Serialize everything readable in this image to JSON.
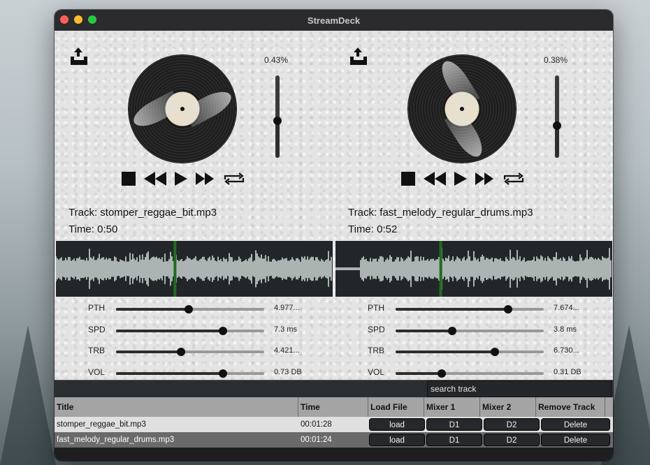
{
  "window": {
    "title": "StreamDeck"
  },
  "deck_left": {
    "volume_pct": "0.43%",
    "volume_level": 0.45,
    "track_label": "Track: stomper_reggae_bit.mp3",
    "time_label": "Time: 0:50",
    "playhead": 0.43,
    "params": [
      {
        "name": "PTH",
        "value": "4.977...",
        "level": 0.49
      },
      {
        "name": "SPD",
        "value": "7.3 ms",
        "level": 0.72
      },
      {
        "name": "TRB",
        "value": "4.421...",
        "level": 0.44
      },
      {
        "name": "VOL",
        "value": "0.73 DB",
        "level": 0.72
      }
    ]
  },
  "deck_right": {
    "volume_pct": "0.38%",
    "volume_level": 0.39,
    "track_label": "Track: fast_melody_regular_drums.mp3",
    "time_label": "Time: 0:52",
    "playhead": 0.38,
    "params": [
      {
        "name": "PTH",
        "value": "7.674...",
        "level": 0.76
      },
      {
        "name": "SPD",
        "value": "3.8 ms",
        "level": 0.38
      },
      {
        "name": "TRB",
        "value": "6.730...",
        "level": 0.67
      },
      {
        "name": "VOL",
        "value": "0.31 DB",
        "level": 0.31
      }
    ]
  },
  "icons": {
    "eject": "eject-tray-icon",
    "stop": "stop-icon",
    "rewind": "rewind-icon",
    "play": "play-icon",
    "fast_forward": "fast-forward-icon",
    "loop": "loop-icon"
  },
  "library": {
    "search_placeholder": "search track",
    "columns": [
      "Title",
      "Time",
      "Load File",
      "Mixer 1",
      "Mixer 2",
      "Remove Track"
    ],
    "rows": [
      {
        "title": "stomper_reggae_bit.mp3",
        "time": "00:01:28",
        "load": "load",
        "m1": "D1",
        "m2": "D2",
        "remove": "Delete"
      },
      {
        "title": "fast_melody_regular_drums.mp3",
        "time": "00:01:24",
        "load": "load",
        "m1": "D1",
        "m2": "D2",
        "remove": "Delete"
      }
    ]
  },
  "colors": {
    "playhead": "#1f6b22",
    "waveform": "#cfd8d6",
    "wave_bg": "#222629"
  }
}
